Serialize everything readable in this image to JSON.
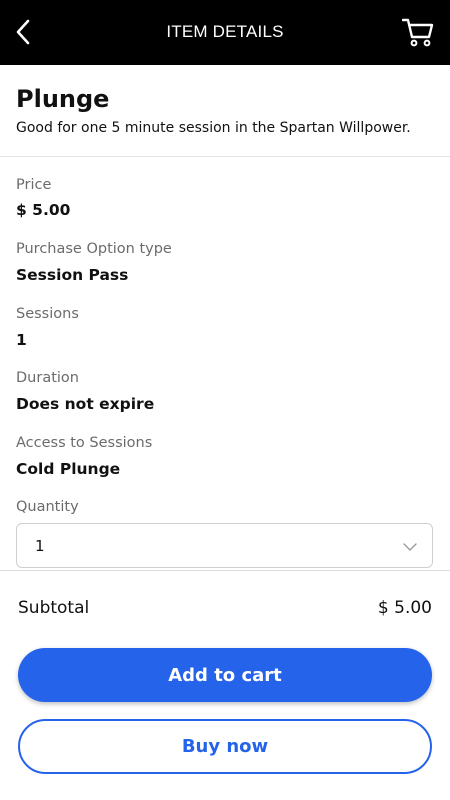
{
  "header": {
    "title": "ITEM DETAILS",
    "back_icon": "chevron-left-icon",
    "cart_icon": "cart-icon"
  },
  "item": {
    "title": "Plunge",
    "description": "Good for one 5 minute session in the Spartan Willpower."
  },
  "details": {
    "price_label": "Price",
    "price_value": "$ 5.00",
    "purchase_option_label": "Purchase Option type",
    "purchase_option_value": "Session Pass",
    "sessions_label": "Sessions",
    "sessions_value": "1",
    "duration_label": "Duration",
    "duration_value": "Does not expire",
    "access_label": "Access to Sessions",
    "access_value": "Cold Plunge",
    "quantity_label": "Quantity",
    "quantity_value": "1"
  },
  "summary": {
    "subtotal_label": "Subtotal",
    "subtotal_value": "$ 5.00"
  },
  "actions": {
    "add_to_cart_label": "Add to cart",
    "buy_now_label": "Buy now"
  },
  "colors": {
    "accent": "#2563eb",
    "topbar": "#000000"
  }
}
